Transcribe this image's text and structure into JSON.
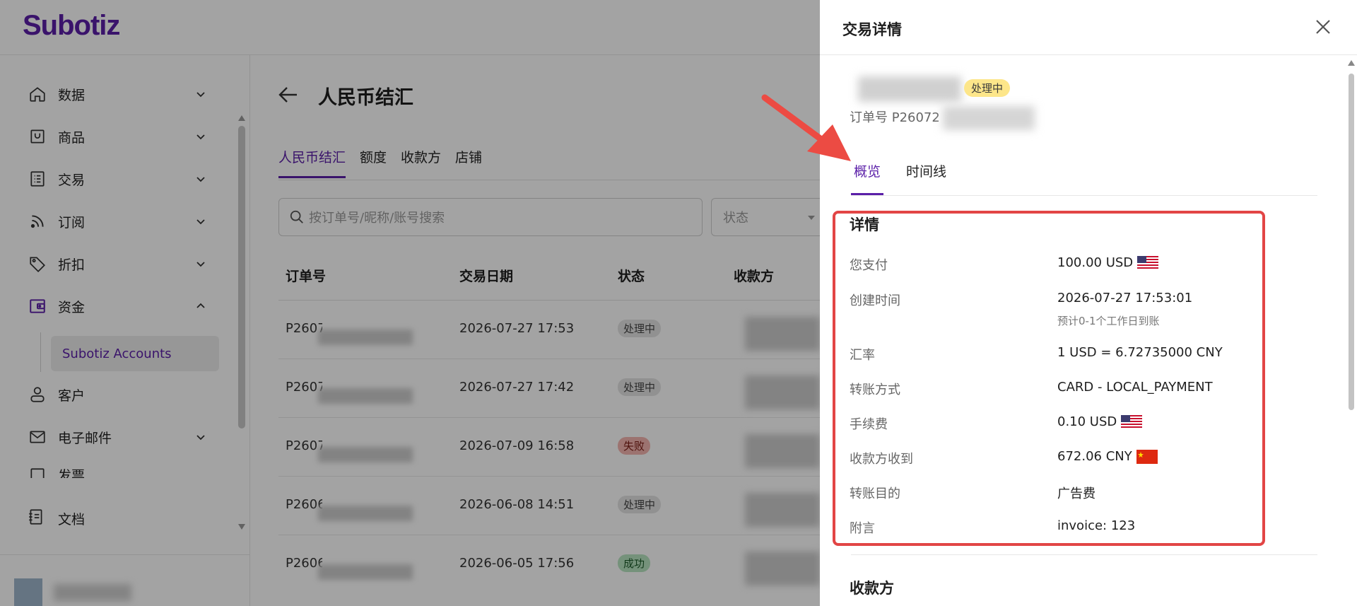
{
  "brand": {
    "logo": "Subotiz"
  },
  "sidebar": {
    "items": [
      {
        "label": "数据",
        "icon": "home-icon"
      },
      {
        "label": "商品",
        "icon": "store-icon"
      },
      {
        "label": "交易",
        "icon": "list-icon"
      },
      {
        "label": "订阅",
        "icon": "rss-icon"
      },
      {
        "label": "折扣",
        "icon": "tag-icon"
      },
      {
        "label": "资金",
        "icon": "wallet-icon",
        "expanded": true
      },
      {
        "label": "客户",
        "icon": "user-icon"
      },
      {
        "label": "电子邮件",
        "icon": "mail-icon"
      },
      {
        "label": "发票",
        "icon": "invoice-icon"
      }
    ],
    "sub_item": "Subotiz Accounts",
    "docs": "文档"
  },
  "main": {
    "title": "人民币结汇",
    "tabs": [
      "人民币结汇",
      "额度",
      "收款方",
      "店铺"
    ],
    "search_placeholder": "按订单号/昵称/账号搜索",
    "status_filter": "状态",
    "columns": [
      "订单号",
      "交易日期",
      "状态",
      "收款方"
    ],
    "rows": [
      {
        "order": "P2607",
        "date": "2026-07-27 17:53",
        "status": "处理中",
        "status_type": "processing"
      },
      {
        "order": "P2607",
        "date": "2026-07-27 17:42",
        "status": "处理中",
        "status_type": "processing"
      },
      {
        "order": "P2607",
        "date": "2026-07-09 16:58",
        "status": "失败",
        "status_type": "failed"
      },
      {
        "order": "P2606",
        "date": "2026-06-08 14:51",
        "status": "处理中",
        "status_type": "processing"
      },
      {
        "order": "P2606",
        "date": "2026-06-05 17:56",
        "status": "成功",
        "status_type": "success"
      }
    ]
  },
  "drawer": {
    "title": "交易详情",
    "status_badge": "处理中",
    "order_label": "订单号 P26072",
    "tabs": [
      "概览",
      "时间线"
    ],
    "details_title": "详情",
    "details": [
      {
        "key": "您支付",
        "value": "100.00 USD",
        "flag": "us-flag-icon"
      },
      {
        "key": "创建时间",
        "value": "2026-07-27 17:53:01",
        "note": "预计0-1个工作日到账"
      },
      {
        "key": "汇率",
        "value": "1 USD = 6.72735000 CNY"
      },
      {
        "key": "转账方式",
        "value": "CARD - LOCAL_PAYMENT"
      },
      {
        "key": "手续费",
        "value": "0.10 USD",
        "flag": "us-flag-icon"
      },
      {
        "key": "收款方收到",
        "value": "672.06 CNY",
        "flag": "cn-flag-icon"
      },
      {
        "key": "转账目的",
        "value": "广告费"
      },
      {
        "key": "附言",
        "value": "invoice: 123"
      }
    ],
    "payee_title": "收款方"
  },
  "colors": {
    "brand": "#5b1fa8",
    "annotation": "#e24545",
    "badge_processing": "#fde68a",
    "badge_failed": "#f5b5b0",
    "badge_success": "#b7e4c0"
  }
}
